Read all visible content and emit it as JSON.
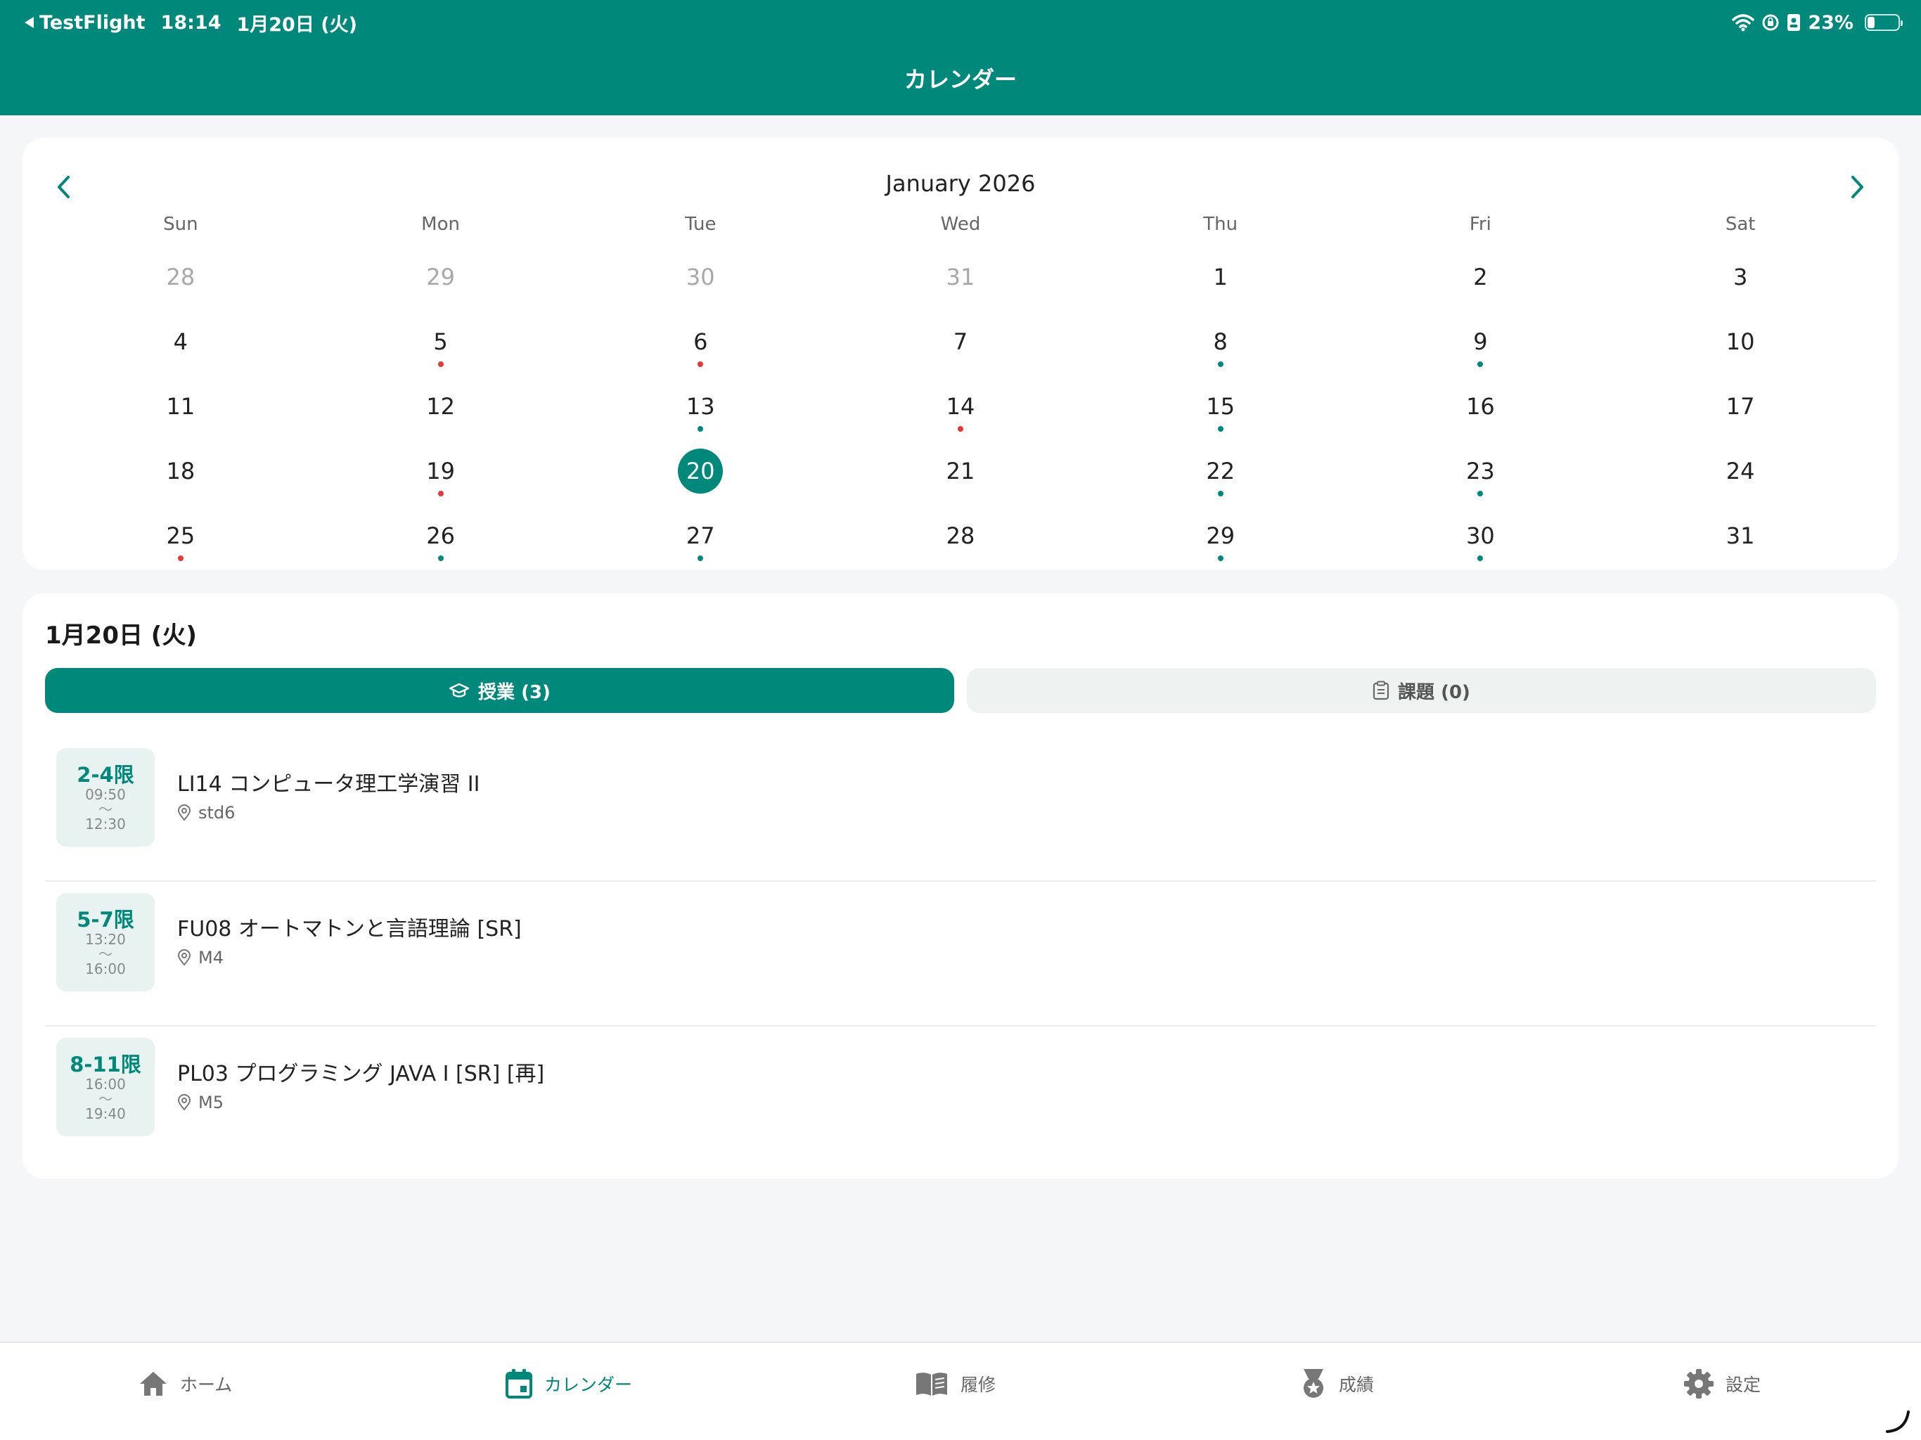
{
  "status": {
    "back_label": "TestFlight",
    "time": "18:14",
    "date": "1月20日 (火)",
    "battery": "23%",
    "battery_level": 0.23
  },
  "header": {
    "title": "カレンダー"
  },
  "calendar": {
    "month_title": "January 2026",
    "weekdays": [
      "Sun",
      "Mon",
      "Tue",
      "Wed",
      "Thu",
      "Fri",
      "Sat"
    ],
    "days": [
      {
        "n": "28",
        "muted": true
      },
      {
        "n": "29",
        "muted": true
      },
      {
        "n": "30",
        "muted": true
      },
      {
        "n": "31",
        "muted": true
      },
      {
        "n": "1"
      },
      {
        "n": "2"
      },
      {
        "n": "3"
      },
      {
        "n": "4"
      },
      {
        "n": "5",
        "dot": "red"
      },
      {
        "n": "6",
        "dot": "red"
      },
      {
        "n": "7"
      },
      {
        "n": "8",
        "dot": "teal"
      },
      {
        "n": "9",
        "dot": "teal"
      },
      {
        "n": "10"
      },
      {
        "n": "11"
      },
      {
        "n": "12"
      },
      {
        "n": "13",
        "dot": "teal"
      },
      {
        "n": "14",
        "dot": "red"
      },
      {
        "n": "15",
        "dot": "teal"
      },
      {
        "n": "16"
      },
      {
        "n": "17"
      },
      {
        "n": "18"
      },
      {
        "n": "19",
        "dot": "red"
      },
      {
        "n": "20",
        "selected": true
      },
      {
        "n": "21"
      },
      {
        "n": "22",
        "dot": "teal"
      },
      {
        "n": "23",
        "dot": "teal"
      },
      {
        "n": "24"
      },
      {
        "n": "25",
        "dot": "red"
      },
      {
        "n": "26",
        "dot": "teal"
      },
      {
        "n": "27",
        "dot": "teal"
      },
      {
        "n": "28"
      },
      {
        "n": "29",
        "dot": "teal"
      },
      {
        "n": "30",
        "dot": "teal"
      },
      {
        "n": "31"
      }
    ]
  },
  "schedule": {
    "date_label": "1月20日 (火)",
    "tabs": {
      "lessons": "授業 (3)",
      "assignments": "課題 (0)"
    },
    "lessons": [
      {
        "period": "2-4限",
        "start": "09:50",
        "tilde": "〜",
        "end": "12:30",
        "title": "LI14 コンピュータ理工学演習 II",
        "room": "std6"
      },
      {
        "period": "5-7限",
        "start": "13:20",
        "tilde": "〜",
        "end": "16:00",
        "title": "FU08 オートマトンと言語理論 [SR]",
        "room": "M4"
      },
      {
        "period": "8-11限",
        "start": "16:00",
        "tilde": "〜",
        "end": "19:40",
        "title": "PL03 プログラミング JAVA I [SR] [再]",
        "room": "M5"
      }
    ]
  },
  "tabbar": {
    "home": "ホーム",
    "calendar": "カレンダー",
    "courses": "履修",
    "grades": "成績",
    "settings": "設定"
  },
  "colors": {
    "accent": "#00897b",
    "dot_red": "#e53935",
    "dot_teal": "#00897b"
  }
}
